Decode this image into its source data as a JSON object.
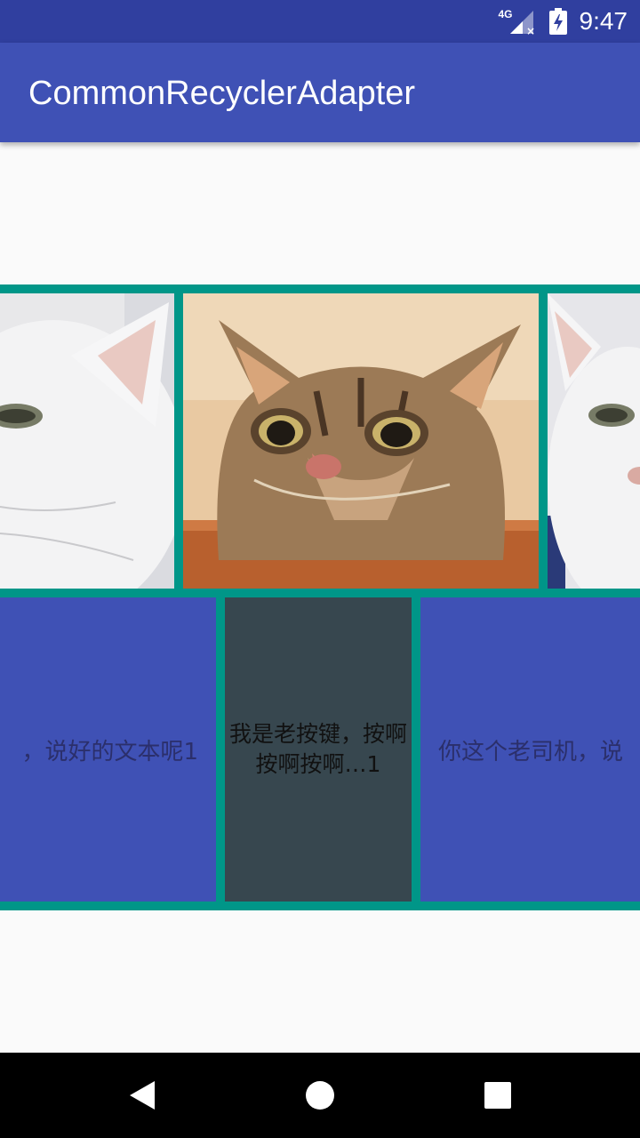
{
  "status_bar": {
    "time": "9:47",
    "network": "4G",
    "icons": [
      "signal-icon",
      "battery-charging-icon"
    ]
  },
  "app_bar": {
    "title": "CommonRecyclerAdapter"
  },
  "image_row": {
    "items": [
      {
        "icon": "white-cat-photo"
      },
      {
        "icon": "tabby-cat-photo"
      },
      {
        "icon": "white-cat-photo"
      }
    ]
  },
  "text_row": {
    "items": [
      {
        "text": "，说好的文本呢1"
      },
      {
        "text": "我是老按键，按啊按啊按啊…1"
      },
      {
        "text": "你这个老司机，说"
      }
    ]
  },
  "nav_bar": {
    "icons": [
      "back-icon",
      "home-icon",
      "recents-icon"
    ]
  },
  "colors": {
    "primary": "#3f51b5",
    "primary_dark": "#303f9f",
    "teal": "#009688",
    "dark_card": "#37474f"
  }
}
